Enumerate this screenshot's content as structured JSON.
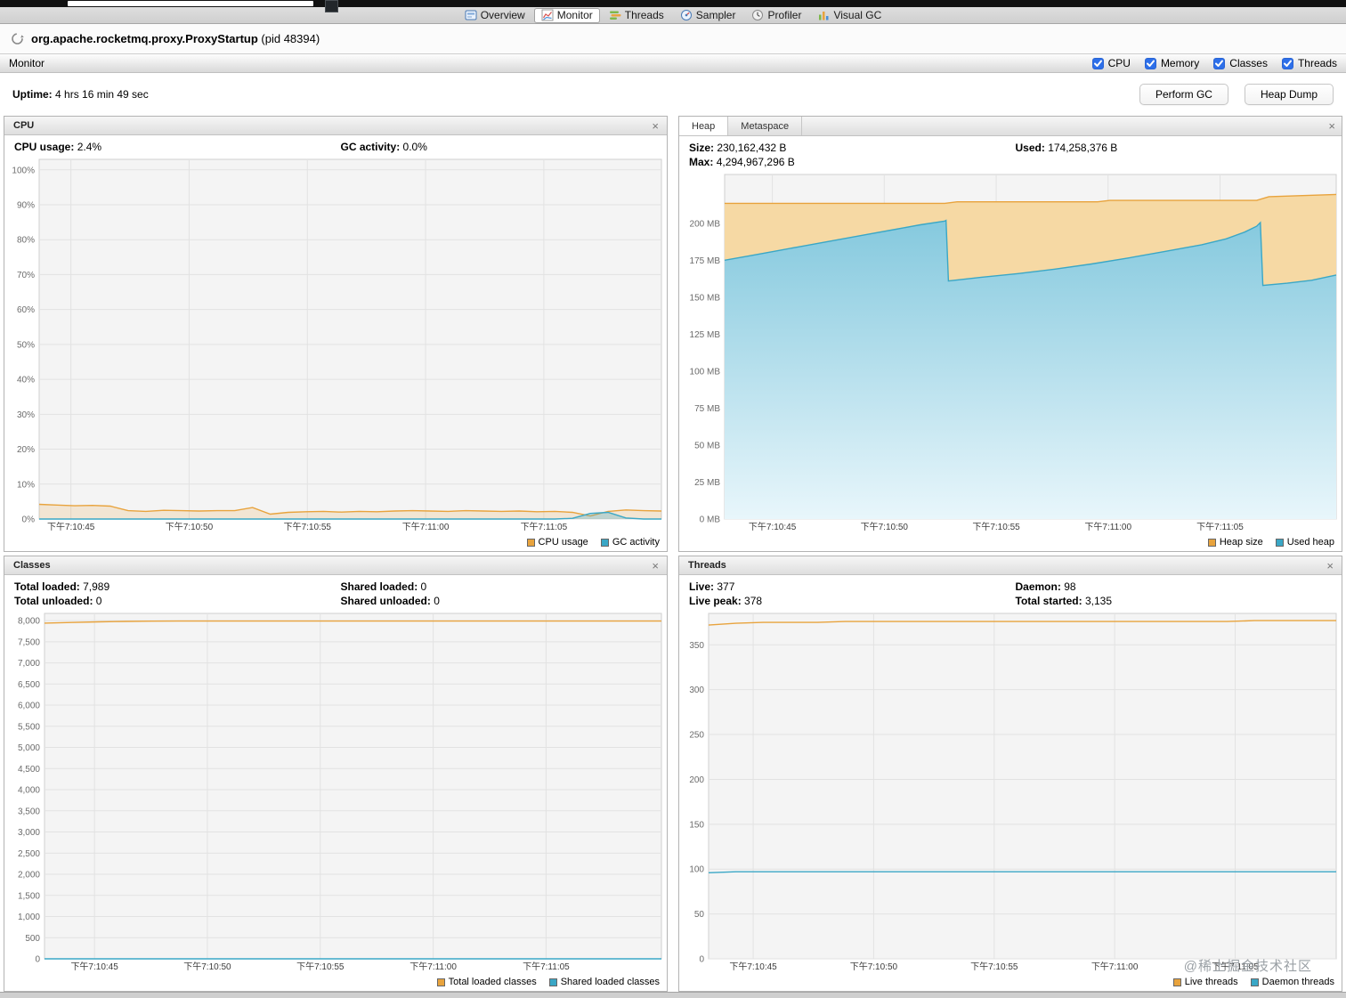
{
  "icons": {
    "close": "×"
  },
  "top_tabs": {
    "items": [
      {
        "label": "Overview",
        "selected": false
      },
      {
        "label": "Monitor",
        "selected": true
      },
      {
        "label": "Threads",
        "selected": false
      },
      {
        "label": "Sampler",
        "selected": false
      },
      {
        "label": "Profiler",
        "selected": false
      },
      {
        "label": "Visual GC",
        "selected": false
      }
    ]
  },
  "header": {
    "title": "org.apache.rocketmq.proxy.ProxyStartup",
    "pid": "(pid 48394)"
  },
  "monitor_bar": {
    "title": "Monitor",
    "checkboxes": [
      {
        "label": "CPU",
        "checked": true
      },
      {
        "label": "Memory",
        "checked": true
      },
      {
        "label": "Classes",
        "checked": true
      },
      {
        "label": "Threads",
        "checked": true
      }
    ]
  },
  "status_row": {
    "uptime_label": "Uptime:",
    "uptime_value": "4 hrs 16 min 49 sec",
    "buttons": [
      {
        "label": "Perform GC"
      },
      {
        "label": "Heap Dump"
      }
    ]
  },
  "panels": {
    "cpu": {
      "title": "CPU",
      "stats_row1": [
        {
          "label": "CPU usage:",
          "value": "2.4%"
        },
        {
          "label": "GC activity:",
          "value": "0.0%"
        }
      ]
    },
    "heap": {
      "tabs": [
        {
          "label": "Heap",
          "selected": true
        },
        {
          "label": "Metaspace",
          "selected": false
        }
      ],
      "stats_row1": [
        {
          "label": "Size:",
          "value": "230,162,432 B"
        },
        {
          "label": "Used:",
          "value": "174,258,376 B"
        }
      ],
      "stats_row2": [
        {
          "label": "Max:",
          "value": "4,294,967,296 B"
        }
      ]
    },
    "classes": {
      "title": "Classes",
      "stats_row1": [
        {
          "label": "Total loaded:",
          "value": "7,989"
        },
        {
          "label": "Shared loaded:",
          "value": "0"
        }
      ],
      "stats_row2": [
        {
          "label": "Total unloaded:",
          "value": "0"
        },
        {
          "label": "Shared unloaded:",
          "value": "0"
        }
      ]
    },
    "threads": {
      "title": "Threads",
      "stats_row1": [
        {
          "label": "Live:",
          "value": "377"
        },
        {
          "label": "Daemon:",
          "value": "98"
        }
      ],
      "stats_row2": [
        {
          "label": "Live peak:",
          "value": "378"
        },
        {
          "label": "Total started:",
          "value": "3,135"
        }
      ]
    }
  },
  "watermark": "@稀土掘金技术社区",
  "chart_data": [
    {
      "id": "cpu",
      "type": "area",
      "title": "CPU",
      "y_unit": "%",
      "ymax": 103,
      "yticks": [
        [
          0,
          "0%"
        ],
        [
          10,
          "10%"
        ],
        [
          20,
          "20%"
        ],
        [
          30,
          "30%"
        ],
        [
          40,
          "40%"
        ],
        [
          50,
          "50%"
        ],
        [
          60,
          "60%"
        ],
        [
          70,
          "70%"
        ],
        [
          80,
          "80%"
        ],
        [
          90,
          "90%"
        ],
        [
          100,
          "100%"
        ]
      ],
      "xticks": [
        [
          0.051,
          "下午7:10:45"
        ],
        [
          0.241,
          "下午7:10:50"
        ],
        [
          0.431,
          "下午7:10:55"
        ],
        [
          0.621,
          "下午7:11:00"
        ],
        [
          0.811,
          "下午7:11:05"
        ]
      ],
      "series": [
        {
          "name": "CPU usage",
          "color": "#E8A33D",
          "fill": "rgba(232,163,61,0.18)",
          "values": [
            4.2,
            4.0,
            3.8,
            3.9,
            3.7,
            2.4,
            2.2,
            2.5,
            2.4,
            2.3,
            2.4,
            2.4,
            3.3,
            1.4,
            1.9,
            2.1,
            2.2,
            2.0,
            2.2,
            2.1,
            2.3,
            2.4,
            2.3,
            2.2,
            2.4,
            2.3,
            2.2,
            2.3,
            2.1,
            2.2,
            1.9,
            0.9,
            2.2,
            2.6,
            2.4,
            2.3
          ]
        },
        {
          "name": "GC activity",
          "color": "#3AA7C6",
          "fill": "rgba(58,167,198,0.28)",
          "values": [
            0,
            0,
            0,
            0,
            0,
            0,
            0,
            0,
            0,
            0,
            0,
            0,
            0,
            0,
            0,
            0,
            0,
            0,
            0,
            0,
            0,
            0,
            0,
            0,
            0,
            0,
            0,
            0,
            0,
            0,
            0.2,
            1.6,
            1.9,
            0.3,
            0,
            0
          ]
        }
      ]
    },
    {
      "id": "heap",
      "type": "area",
      "title": "Heap",
      "y_unit": "MB",
      "ymax": 233,
      "yticks": [
        [
          0,
          "0 MB"
        ],
        [
          25,
          "25 MB"
        ],
        [
          50,
          "50 MB"
        ],
        [
          75,
          "75 MB"
        ],
        [
          100,
          "100 MB"
        ],
        [
          125,
          "125 MB"
        ],
        [
          150,
          "150 MB"
        ],
        [
          175,
          "175 MB"
        ],
        [
          200,
          "200 MB"
        ]
      ],
      "xticks": [
        [
          0.078,
          "下午7:10:45"
        ],
        [
          0.261,
          "下午7:10:50"
        ],
        [
          0.444,
          "下午7:10:55"
        ],
        [
          0.627,
          "下午7:11:00"
        ],
        [
          0.81,
          "下午7:11:05"
        ]
      ],
      "series": [
        {
          "name": "Heap size",
          "color": "#E8A33D",
          "fill": "#F6D9A4",
          "x": [
            0,
            0.36,
            0.38,
            0.61,
            0.63,
            0.87,
            0.89,
            1
          ],
          "values": [
            213.5,
            213.5,
            214.5,
            214.5,
            215.5,
            215.5,
            218,
            219.5
          ]
        },
        {
          "name": "Used heap",
          "color": "#3AA7C6",
          "gradient": [
            "#85C9DE",
            "#E8F6FB"
          ],
          "x": [
            0,
            0.04,
            0.08,
            0.12,
            0.16,
            0.2,
            0.24,
            0.28,
            0.32,
            0.36,
            0.362,
            0.366,
            0.42,
            0.48,
            0.54,
            0.6,
            0.66,
            0.72,
            0.78,
            0.82,
            0.85,
            0.87,
            0.876,
            0.88,
            0.92,
            0.96,
            1
          ],
          "values": [
            175,
            178,
            181,
            184,
            187,
            190,
            193,
            196,
            199,
            201.5,
            202,
            161,
            163.5,
            166,
            169,
            172.5,
            176.5,
            181,
            185.5,
            189.5,
            194,
            198,
            200.5,
            158,
            159.5,
            161.5,
            165
          ]
        }
      ]
    },
    {
      "id": "classes",
      "type": "line",
      "title": "Classes",
      "y_unit": "classes",
      "ymax": 8170,
      "yticks": [
        [
          0,
          "0"
        ],
        [
          500,
          "500"
        ],
        [
          1000,
          "1,000"
        ],
        [
          1500,
          "1,500"
        ],
        [
          2000,
          "2,000"
        ],
        [
          2500,
          "2,500"
        ],
        [
          3000,
          "3,000"
        ],
        [
          3500,
          "3,500"
        ],
        [
          4000,
          "4,000"
        ],
        [
          4500,
          "4,500"
        ],
        [
          5000,
          "5,000"
        ],
        [
          5500,
          "5,500"
        ],
        [
          6000,
          "6,000"
        ],
        [
          6500,
          "6,500"
        ],
        [
          7000,
          "7,000"
        ],
        [
          7500,
          "7,500"
        ],
        [
          8000,
          "8,000"
        ]
      ],
      "xticks": [
        [
          0.081,
          "下午7:10:45"
        ],
        [
          0.264,
          "下午7:10:50"
        ],
        [
          0.447,
          "下午7:10:55"
        ],
        [
          0.63,
          "下午7:11:00"
        ],
        [
          0.813,
          "下午7:11:05"
        ]
      ],
      "series": [
        {
          "name": "Total loaded classes",
          "color": "#E8A33D",
          "values": [
            7940,
            7956,
            7970,
            7980,
            7986,
            7989,
            7989,
            7989,
            7989,
            7989,
            7989,
            7989,
            7989,
            7989,
            7989,
            7989,
            7989,
            7989,
            7989,
            7989,
            7989,
            7989,
            7989,
            7989
          ]
        },
        {
          "name": "Shared loaded classes",
          "color": "#3AA7C6",
          "values": [
            0,
            0,
            0,
            0,
            0,
            0,
            0,
            0,
            0,
            0,
            0,
            0,
            0,
            0,
            0,
            0,
            0,
            0,
            0,
            0,
            0,
            0,
            0,
            0
          ]
        }
      ]
    },
    {
      "id": "threads",
      "type": "line",
      "title": "Threads",
      "y_unit": "threads",
      "ymax": 385,
      "yticks": [
        [
          0,
          "0"
        ],
        [
          50,
          "50"
        ],
        [
          100,
          "100"
        ],
        [
          150,
          "150"
        ],
        [
          200,
          "200"
        ],
        [
          250,
          "250"
        ],
        [
          300,
          "300"
        ],
        [
          350,
          "350"
        ]
      ],
      "xticks": [
        [
          0.071,
          "下午7:10:45"
        ],
        [
          0.263,
          "下午7:10:50"
        ],
        [
          0.455,
          "下午7:10:55"
        ],
        [
          0.647,
          "下午7:11:00"
        ],
        [
          0.839,
          "下午7:11:05"
        ]
      ],
      "series": [
        {
          "name": "Live threads",
          "color": "#E8A33D",
          "values": [
            372,
            374,
            375,
            375,
            375,
            376,
            376,
            376,
            376,
            376,
            376,
            376,
            376,
            376,
            376,
            376,
            376,
            376,
            376,
            376,
            377,
            377,
            377,
            377
          ]
        },
        {
          "name": "Daemon threads",
          "color": "#3AA7C6",
          "values": [
            96,
            97,
            97,
            97,
            97,
            97,
            97,
            97,
            97,
            97,
            97,
            97,
            97,
            97,
            97,
            97,
            97,
            97,
            97,
            97,
            97,
            97,
            97,
            97
          ]
        }
      ]
    }
  ]
}
